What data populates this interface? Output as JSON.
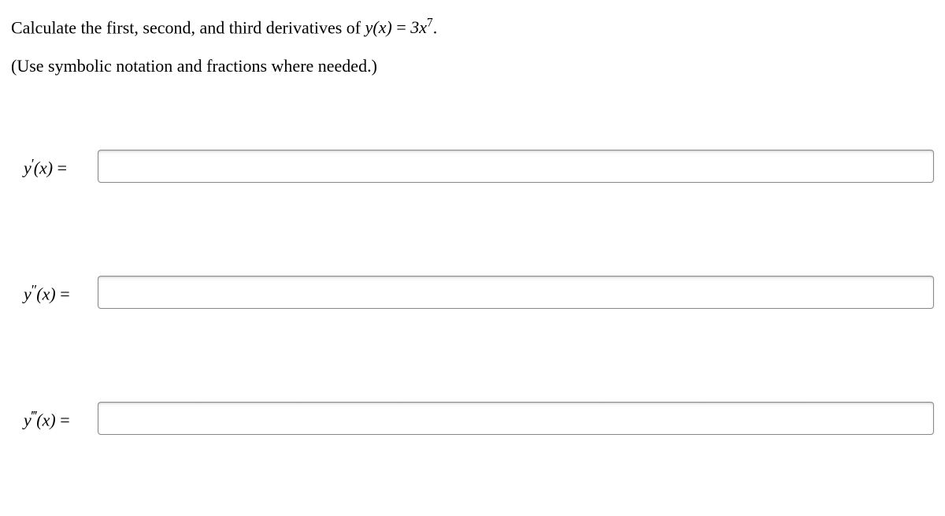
{
  "prompt": {
    "prefix": "Calculate the first, second, and third derivatives of ",
    "function_name": "y",
    "function_arg": "x",
    "coefficient": "3",
    "base": "x",
    "exponent": "7",
    "suffix": "."
  },
  "instruction": "(Use symbolic notation and fractions where needed.)",
  "answers": [
    {
      "label_y": "y",
      "label_prime": "′",
      "label_arg": "x",
      "equals": " = ",
      "value": ""
    },
    {
      "label_y": "y",
      "label_prime": "″",
      "label_arg": "x",
      "equals": " = ",
      "value": ""
    },
    {
      "label_y": "y",
      "label_prime": "‴",
      "label_arg": "x",
      "equals": " = ",
      "value": ""
    }
  ]
}
